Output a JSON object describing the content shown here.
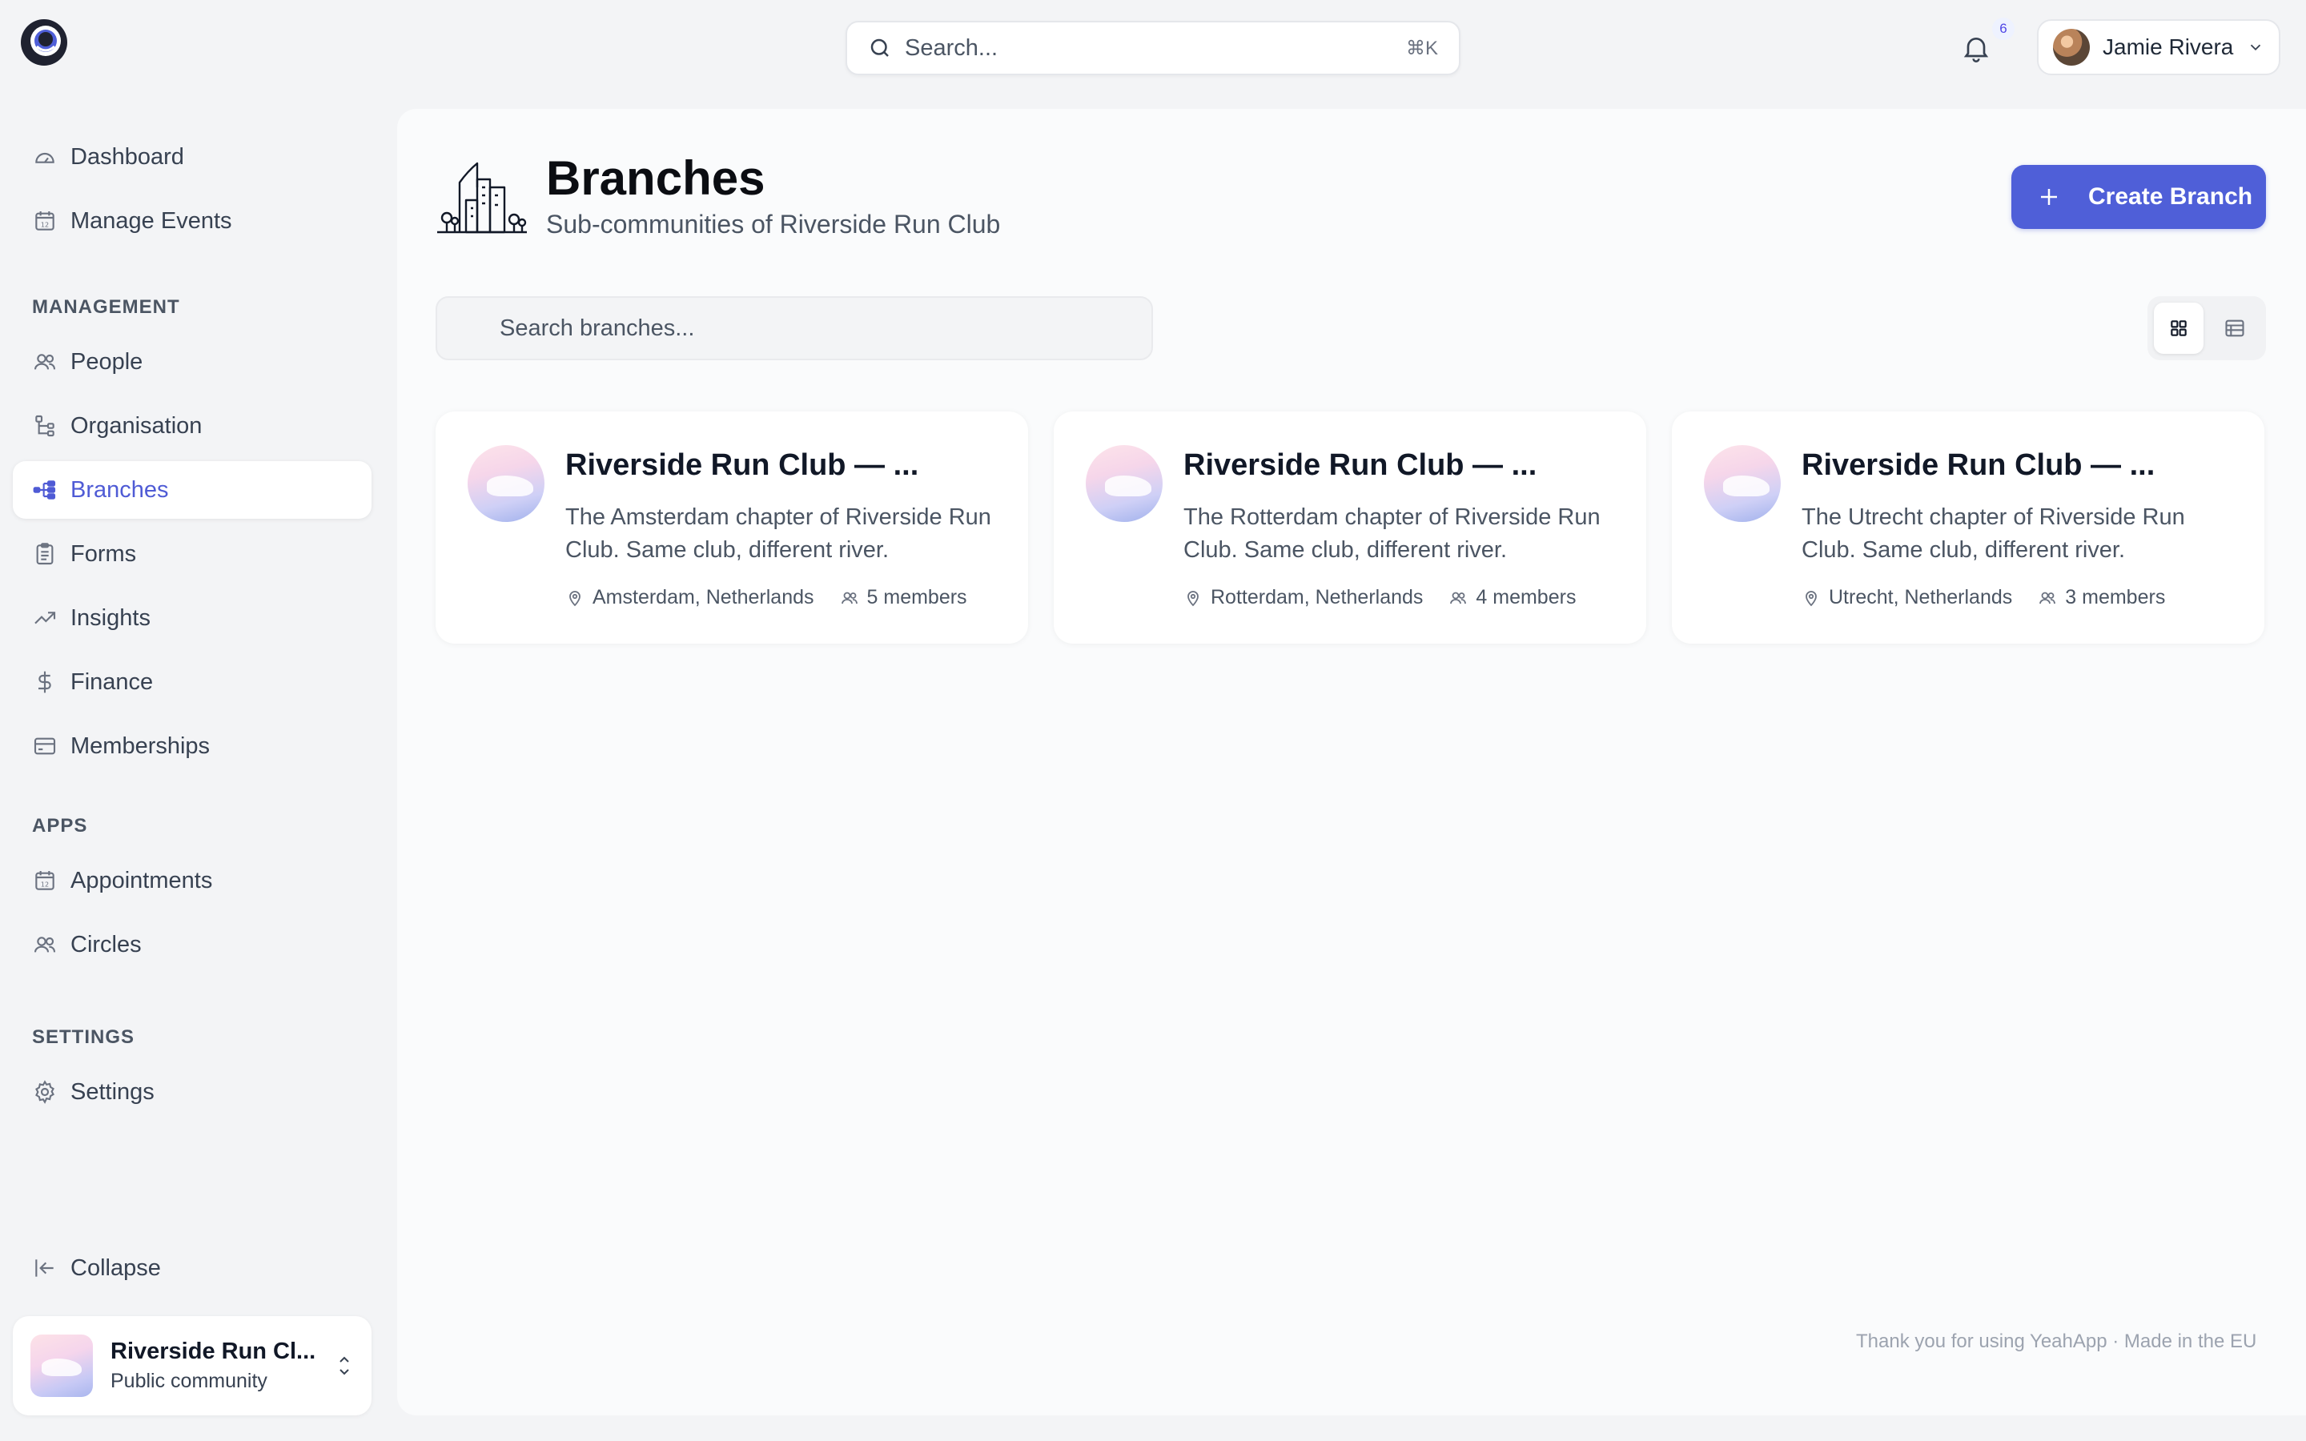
{
  "topbar": {
    "search_placeholder": "Search...",
    "search_shortcut": "⌘K",
    "notifications_count": "6",
    "user_name": "Jamie Rivera"
  },
  "sidebar": {
    "primary": [
      {
        "label": "Dashboard",
        "icon": "gauge-icon"
      },
      {
        "label": "Manage Events",
        "icon": "calendar-icon"
      }
    ],
    "management_label": "MANAGEMENT",
    "management": [
      {
        "label": "People",
        "icon": "users-icon"
      },
      {
        "label": "Organisation",
        "icon": "hierarchy-icon"
      },
      {
        "label": "Branches",
        "icon": "branches-icon",
        "active": true
      },
      {
        "label": "Forms",
        "icon": "clipboard-icon"
      },
      {
        "label": "Insights",
        "icon": "trend-icon"
      },
      {
        "label": "Finance",
        "icon": "dollar-icon"
      },
      {
        "label": "Memberships",
        "icon": "card-icon"
      }
    ],
    "apps_label": "APPS",
    "apps": [
      {
        "label": "Appointments",
        "icon": "calendar-icon"
      },
      {
        "label": "Circles",
        "icon": "users-icon"
      }
    ],
    "settings_label": "SETTINGS",
    "settings": [
      {
        "label": "Settings",
        "icon": "gear-icon"
      }
    ],
    "collapse_label": "Collapse",
    "community": {
      "name": "Riverside Run Cl...",
      "type": "Public community"
    }
  },
  "page": {
    "title": "Branches",
    "subtitle": "Sub-communities of Riverside Run Club",
    "create_button": "Create Branch",
    "search_placeholder": "Search branches...",
    "view_mode": "grid"
  },
  "branches": [
    {
      "name": "Riverside Run Club — ...",
      "description": "The Amsterdam chapter of Riverside Run Club. Same club, different river.",
      "location": "Amsterdam, Netherlands",
      "members": "5 members"
    },
    {
      "name": "Riverside Run Club — ...",
      "description": "The Rotterdam chapter of Riverside Run Club. Same club, different river.",
      "location": "Rotterdam, Netherlands",
      "members": "4 members"
    },
    {
      "name": "Riverside Run Club — ...",
      "description": "The Utrecht chapter of Riverside Run Club. Same club, different river.",
      "location": "Utrecht, Netherlands",
      "members": "3 members"
    }
  ],
  "footer": "Thank you for using YeahApp · Made in the EU",
  "colors": {
    "accent": "#4f5fd8",
    "active_nav": "#4f5bd5",
    "badge_text": "#4f46e5"
  }
}
